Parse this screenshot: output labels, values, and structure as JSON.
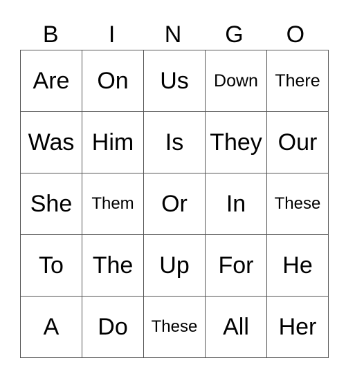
{
  "card": {
    "header": [
      "B",
      "I",
      "N",
      "G",
      "O"
    ],
    "rows": [
      [
        "Are",
        "On",
        "Us",
        "Down",
        "There"
      ],
      [
        "Was",
        "Him",
        "Is",
        "They",
        "Our"
      ],
      [
        "She",
        "Them",
        "Or",
        "In",
        "These"
      ],
      [
        "To",
        "The",
        "Up",
        "For",
        "He"
      ],
      [
        "A",
        "Do",
        "These",
        "All",
        "Her"
      ]
    ]
  }
}
